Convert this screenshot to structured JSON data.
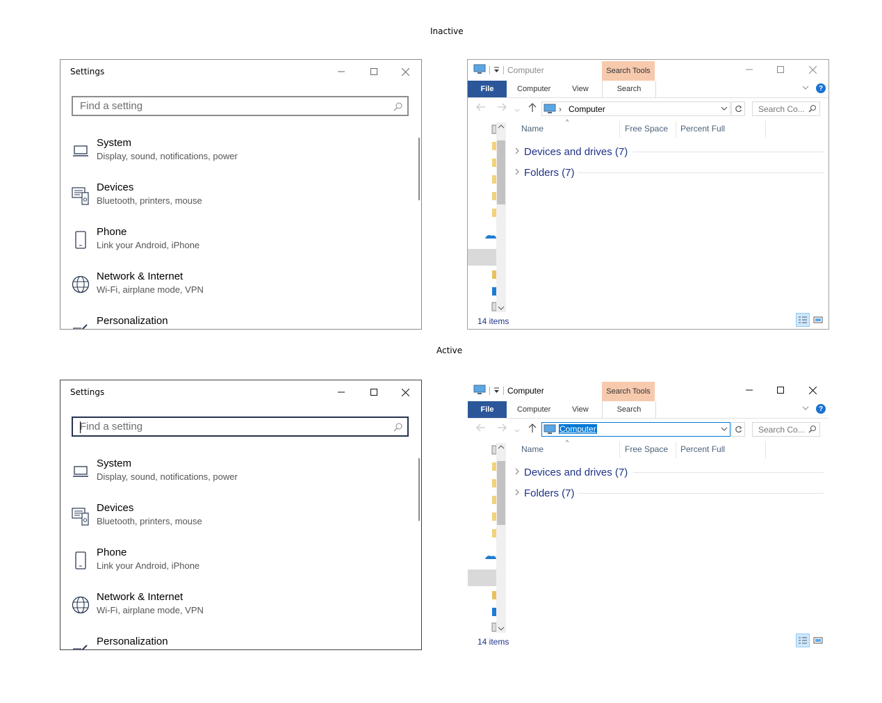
{
  "captions": {
    "inactive": "Inactive",
    "active": "Active"
  },
  "settings": {
    "title": "Settings",
    "search_placeholder": "Find a setting",
    "items": [
      {
        "title": "System",
        "desc": "Display, sound, notifications, power",
        "icon": "laptop-icon"
      },
      {
        "title": "Devices",
        "desc": "Bluetooth, printers, mouse",
        "icon": "devices-icon"
      },
      {
        "title": "Phone",
        "desc": "Link your Android, iPhone",
        "icon": "phone-icon"
      },
      {
        "title": "Network & Internet",
        "desc": "Wi-Fi, airplane mode, VPN",
        "icon": "globe-icon"
      },
      {
        "title": "Personalization",
        "desc": "",
        "icon": "personalization-icon"
      }
    ]
  },
  "explorer": {
    "title": "Computer",
    "contextual_tab": "Search Tools",
    "ribbon_tabs": {
      "file": "File",
      "computer": "Computer",
      "view": "View",
      "search": "Search"
    },
    "address_path": "Computer",
    "search_placeholder": "Search Co...",
    "columns": [
      "Name",
      "Free Space",
      "Percent Full"
    ],
    "groups": [
      {
        "label": "Devices and drives (7)"
      },
      {
        "label": "Folders (7)"
      }
    ],
    "status": "14 items",
    "colors": {
      "file_tab": "#2b579a",
      "contextual": "#f7c9ad",
      "accent": "#0078d7"
    }
  }
}
